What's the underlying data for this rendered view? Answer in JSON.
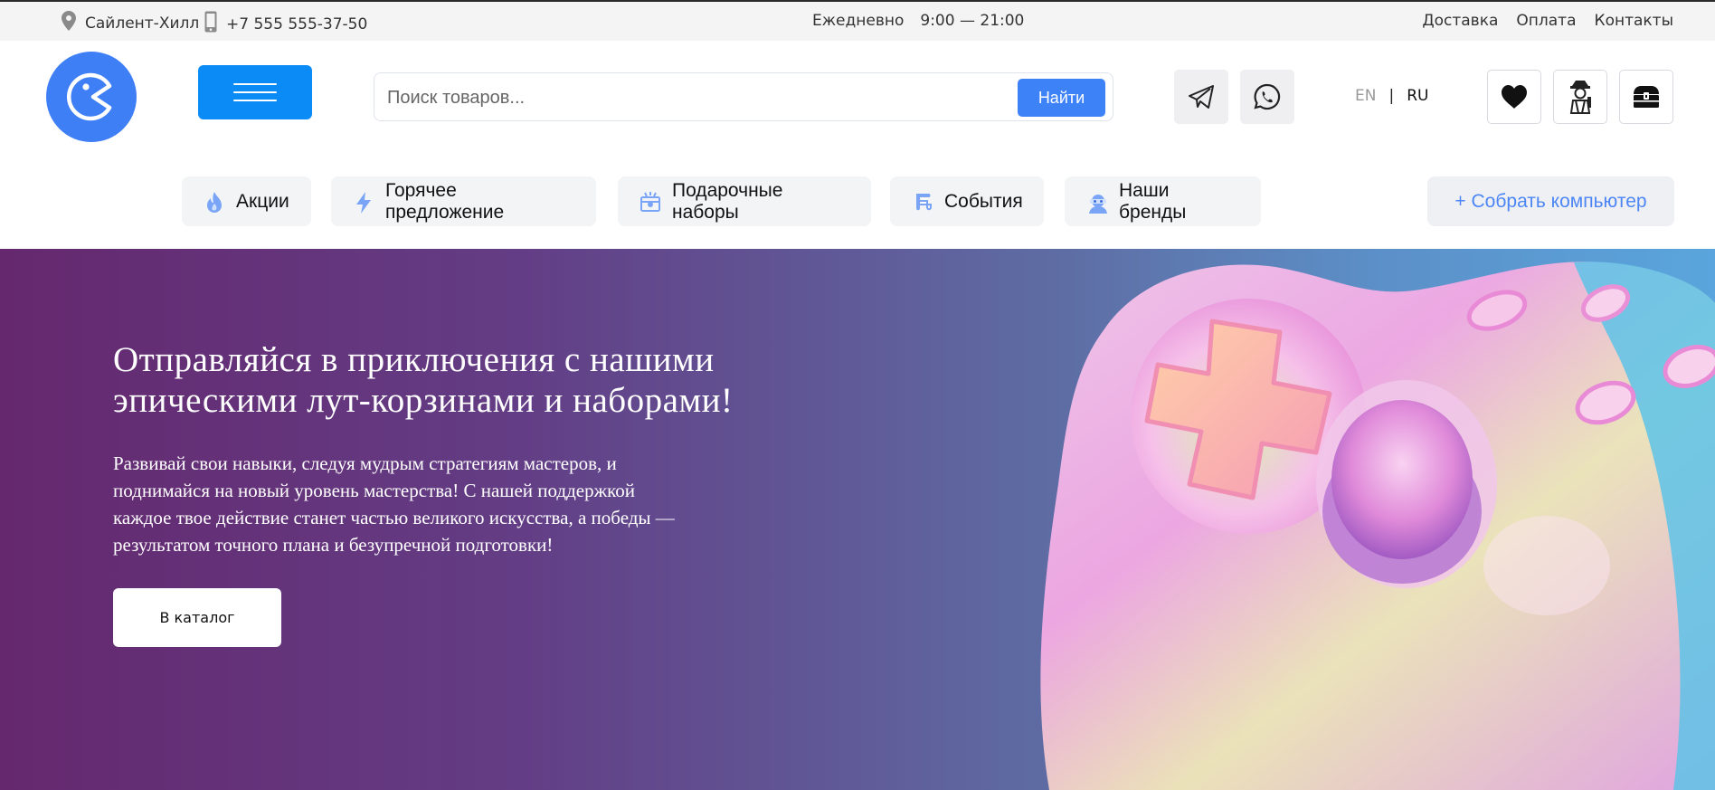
{
  "topbar": {
    "location": "Сайлент-Хилл",
    "phone": "+7 555 555-37-50",
    "hours_label": "Ежедневно",
    "hours_value": "9:00 — 21:00",
    "links": [
      "Доставка",
      "Оплата",
      "Контакты"
    ]
  },
  "header": {
    "search_placeholder": "Поиск товаров...",
    "search_button": "Найти",
    "lang_en": "EN",
    "lang_sep": "|",
    "lang_ru": "RU"
  },
  "categories": [
    {
      "label": "Акции",
      "icon": "fire-icon"
    },
    {
      "label": "Горячее предложение",
      "icon": "lightning-icon"
    },
    {
      "label": "Подарочные наборы",
      "icon": "gift-box-icon"
    },
    {
      "label": "События",
      "icon": "scroll-icon"
    },
    {
      "label": "Наши бренды",
      "icon": "brand-mascot-icon"
    }
  ],
  "build_button": "+ Собрать компьютер",
  "hero": {
    "title_line1": "Отправляйся в приключения с нашими",
    "title_line2": "эпическими лут-корзинами и наборами!",
    "text_line1": "Развивай свои навыки, следуя мудрым стратегиям мастеров, и",
    "text_line2": "поднимайся на новый уровень мастерства! С нашей поддержкой",
    "text_line3": "каждое твое действие станет частью великого искусства, а победы —",
    "text_line4": "результатом точного плана и безупречной подготовки!",
    "cta": "В каталог"
  },
  "colors": {
    "accent": "#3d82f7",
    "menu_button": "#0a8bf5",
    "hero_left": "#65286e",
    "hero_right": "#5aa5dd"
  }
}
